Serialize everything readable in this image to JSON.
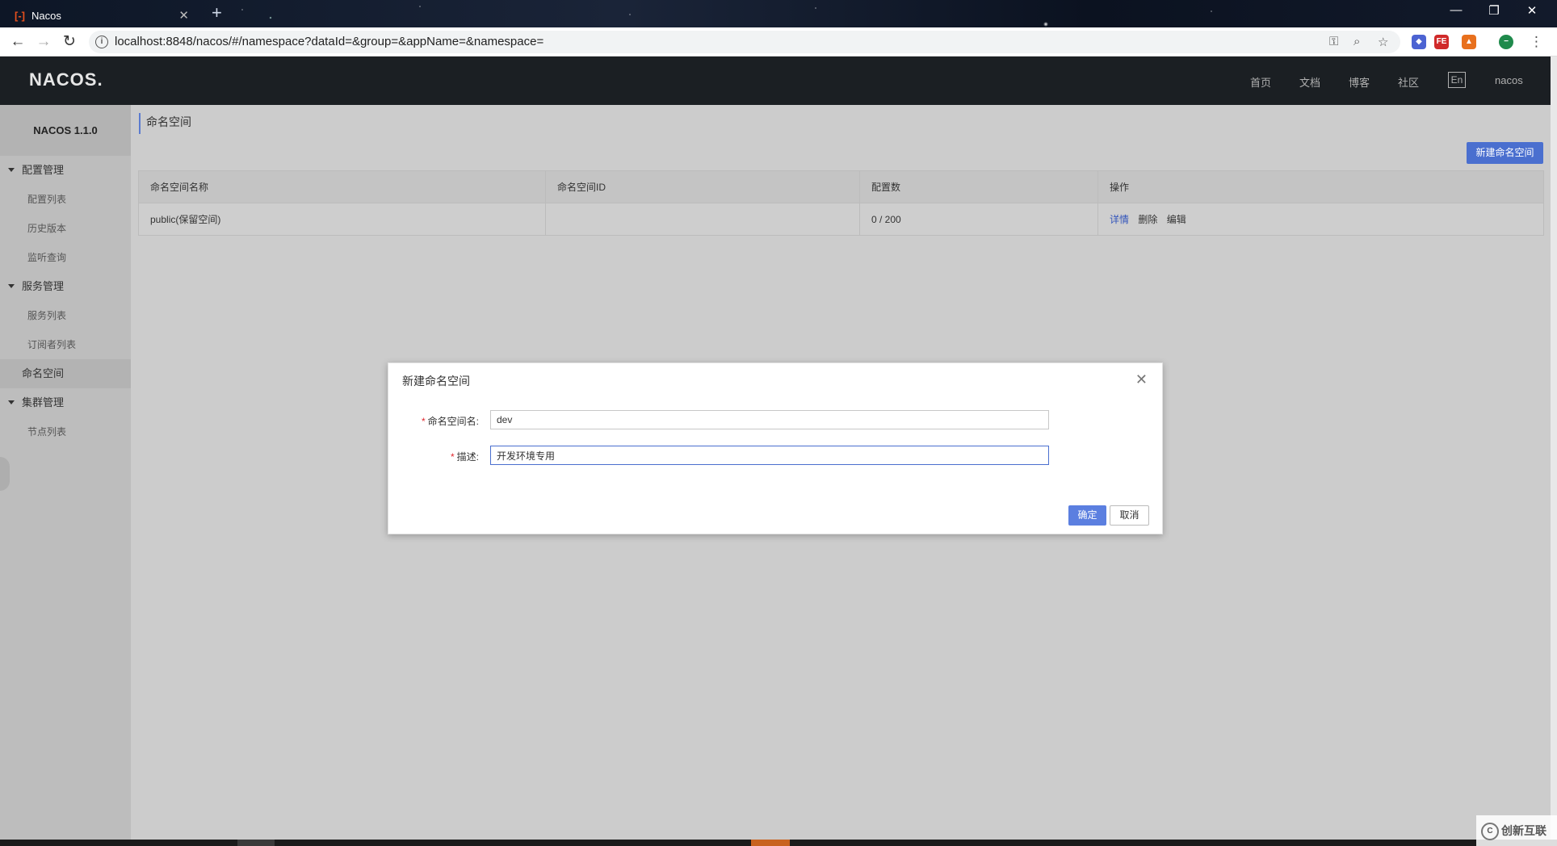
{
  "browser": {
    "tab_title": "Nacos",
    "favicon_glyph": "[-]",
    "url": "localhost:8848/nacos/#/namespace?dataId=&group=&appName=&namespace="
  },
  "header": {
    "logo": "NACOS.",
    "links": [
      "首页",
      "文档",
      "博客",
      "社区"
    ],
    "lang": "En",
    "user": "nacos"
  },
  "sidebar": {
    "version": "NACOS 1.1.0",
    "groups": [
      {
        "label": "配置管理",
        "items": [
          "配置列表",
          "历史版本",
          "监听查询"
        ]
      },
      {
        "label": "服务管理",
        "items": [
          "服务列表",
          "订阅者列表"
        ]
      },
      {
        "label": "命名空间",
        "items": []
      },
      {
        "label": "集群管理",
        "items": [
          "节点列表"
        ]
      }
    ]
  },
  "main": {
    "breadcrumb": "命名空间",
    "create_button": "新建命名空间",
    "table": {
      "headers": [
        "命名空间名称",
        "命名空间ID",
        "配置数",
        "操作"
      ],
      "rows": [
        {
          "name": "public(保留空间)",
          "id": "",
          "count": "0 / 200",
          "ops": [
            "详情",
            "删除",
            "编辑"
          ]
        }
      ]
    }
  },
  "dialog": {
    "title": "新建命名空间",
    "fields": [
      {
        "label": "命名空间名:",
        "required_mark": "*",
        "value": "dev"
      },
      {
        "label": "描述:",
        "required_mark": "*",
        "value": "开发环境专用"
      }
    ],
    "ok": "确定",
    "cancel": "取消"
  },
  "watermark": "创新互联",
  "colors": {
    "primary": "#4a6fcf",
    "header_bg": "#1b1f23",
    "required": "#e0282e"
  }
}
